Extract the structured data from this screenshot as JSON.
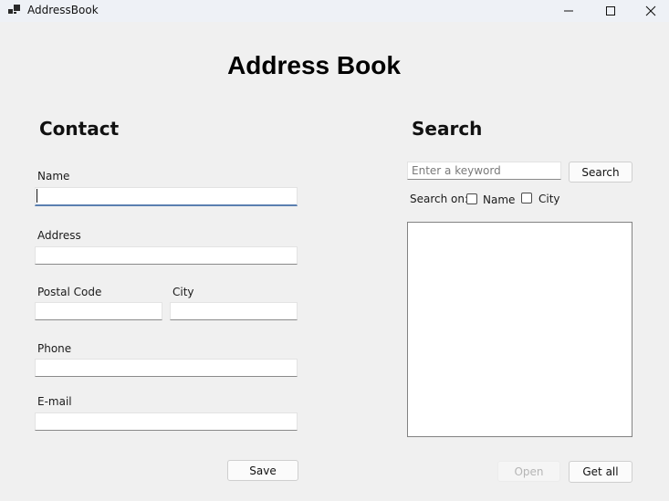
{
  "window": {
    "title": "AddressBook",
    "icon": "app-window-icon",
    "controls": [
      "minimize-icon",
      "maximize-icon",
      "close-icon"
    ]
  },
  "header": {
    "title": "Address Book"
  },
  "contact": {
    "title": "Contact",
    "name_label": "Name",
    "name_value": "",
    "address_label": "Address",
    "address_value": "",
    "postal_code_label": "Postal Code",
    "postal_code_value": "",
    "city_label": "City",
    "city_value": "",
    "phone_label": "Phone",
    "phone_value": "",
    "email_label": "E-mail",
    "email_value": "",
    "save_label": "Save"
  },
  "search": {
    "title": "Search",
    "placeholder": "Enter a keyword",
    "button_label": "Search",
    "search_on_label": "Search on:",
    "option_name": "Name",
    "option_city": "City",
    "open_label": "Open",
    "get_all_label": "Get all"
  }
}
